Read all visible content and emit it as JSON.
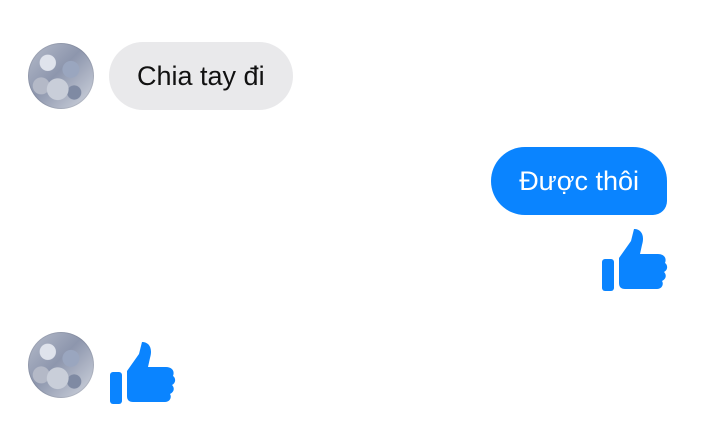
{
  "messages": [
    {
      "from": "contact",
      "type": "text",
      "text": "Chia tay đi"
    },
    {
      "from": "me",
      "type": "text",
      "text": "Được thôi"
    },
    {
      "from": "me",
      "type": "like",
      "icon": "thumbs-up-icon"
    },
    {
      "from": "contact",
      "type": "like",
      "icon": "thumbs-up-icon"
    }
  ],
  "colors": {
    "incoming_bubble": "#e9e9eb",
    "outgoing_bubble": "#0a84ff",
    "like_icon": "#0a84ff"
  }
}
